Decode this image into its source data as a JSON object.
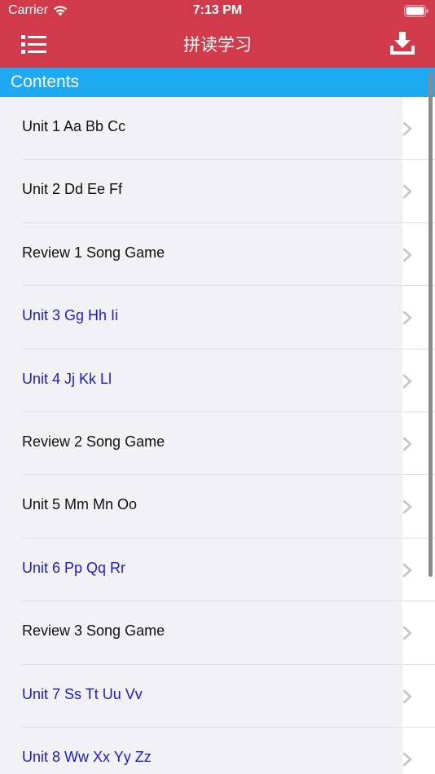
{
  "status_bar": {
    "carrier": "Carrier",
    "time": "7:13 PM",
    "wifi_icon": "wifi-icon",
    "battery_icon": "battery-icon"
  },
  "nav_bar": {
    "title": "拼读学习",
    "menu_icon": "list-menu-icon",
    "download_icon": "download-icon",
    "background_color": "#d13a4a"
  },
  "section": {
    "title": "Contents",
    "background_color": "#1eaaf1"
  },
  "list": {
    "items": [
      {
        "label": "Unit 1 Aa Bb Cc",
        "color": "#111111"
      },
      {
        "label": "Unit 2 Dd Ee Ff",
        "color": "#111111"
      },
      {
        "label": "Review 1 Song Game",
        "color": "#111111"
      },
      {
        "label": "Unit 3 Gg Hh Ii",
        "color": "#1d1ad6"
      },
      {
        "label": "Unit 4 Jj Kk Ll",
        "color": "#1d1ad6"
      },
      {
        "label": "Review 2 Song Game",
        "color": "#111111"
      },
      {
        "label": "Unit 5 Mm Mn Oo",
        "color": "#111111"
      },
      {
        "label": "Unit 6 Pp Qq Rr",
        "color": "#1d1ad6"
      },
      {
        "label": "Review 3 Song Game",
        "color": "#111111"
      },
      {
        "label": "Unit 7 Ss Tt Uu Vv",
        "color": "#1d1ad6"
      },
      {
        "label": "Unit 8 Ww Xx Yy Zz",
        "color": "#1d1ad6"
      }
    ],
    "chevron_icon": "chevron-right-icon"
  }
}
